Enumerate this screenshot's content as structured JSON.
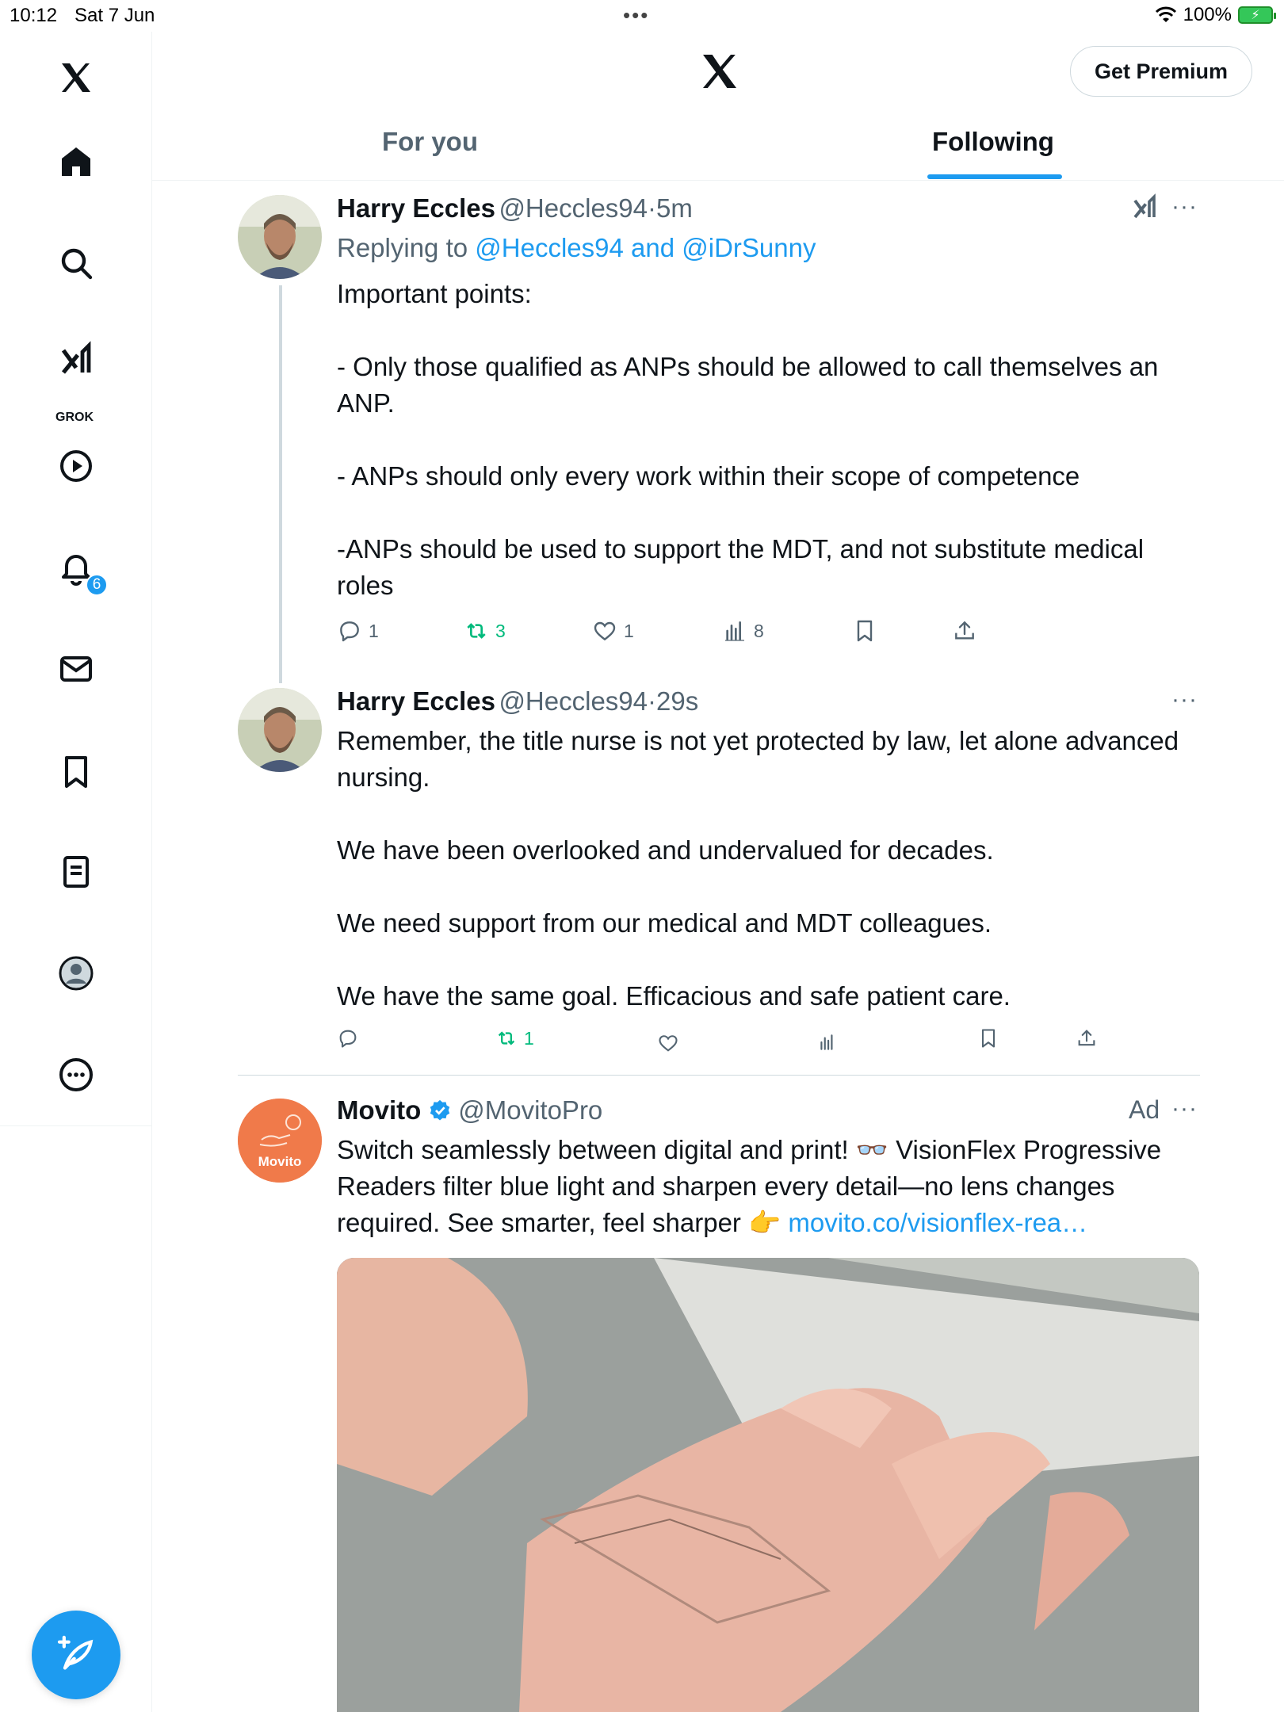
{
  "status_bar": {
    "time": "10:12",
    "date": "Sat 7 Jun",
    "battery": "100%"
  },
  "sidebar": {
    "items": [
      {
        "name": "x-logo-icon"
      },
      {
        "name": "home-icon"
      },
      {
        "name": "search-icon"
      },
      {
        "name": "grok-icon",
        "label": "GROK"
      },
      {
        "name": "video-icon"
      },
      {
        "name": "notifications-icon",
        "badge": "6"
      },
      {
        "name": "messages-icon"
      },
      {
        "name": "bookmarks-icon"
      },
      {
        "name": "lists-icon"
      },
      {
        "name": "profile-icon"
      },
      {
        "name": "more-icon"
      }
    ],
    "compose_icon": "compose-icon"
  },
  "header": {
    "premium_label": "Get Premium",
    "tabs": [
      {
        "label": "For you",
        "active": false
      },
      {
        "label": "Following",
        "active": true
      }
    ]
  },
  "tweets": [
    {
      "name": "Harry Eccles",
      "handle": "@Heccles94",
      "sep": "·",
      "time": "5m",
      "replying_prefix": "Replying to ",
      "replying_links": "@Heccles94 and @iDrSunny",
      "text": "Important points:\n\n- Only those qualified as ANPs should be allowed to call themselves an ANP.\n\n- ANPs should only every work within their scope of competence\n\n-ANPs should be used to support the MDT, and not substitute medical roles",
      "replies": "1",
      "reposts": "3",
      "likes": "1",
      "views": "8"
    },
    {
      "name": "Harry Eccles",
      "handle": "@Heccles94",
      "sep": "·",
      "time": "29s",
      "text": "Remember, the title nurse is not yet protected by law, let alone advanced nursing.\n\nWe have been overlooked and undervalued for decades.\n\nWe need support from our medical and MDT colleagues.\n\nWe have the same goal. Efficacious and safe patient care.",
      "reposts": "1"
    }
  ],
  "ad": {
    "name": "Movito",
    "handle": "@MovitoPro",
    "ad_label": "Ad",
    "avatar_text": "Movito",
    "text_main": "Switch seamlessly between digital and print! 👓 VisionFlex Progressive Readers filter blue light and sharpen every detail—no lens changes required. See smarter, feel sharper 👉 ",
    "link": "movito.co/visionflex-rea…"
  },
  "colors": {
    "accent": "#1d9bf0",
    "repost_green": "#00ba7c",
    "muted": "#536471",
    "movito_orange": "#f07a4a"
  }
}
